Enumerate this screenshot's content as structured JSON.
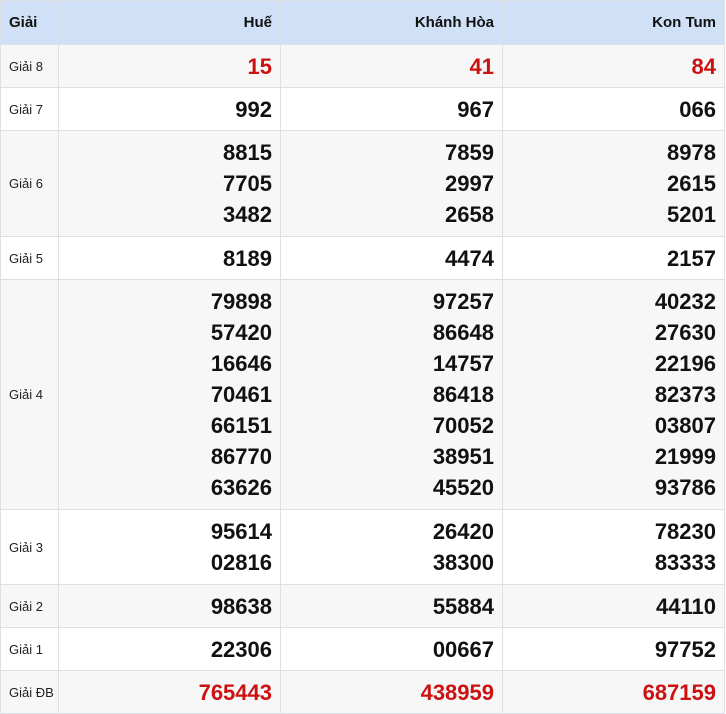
{
  "header": {
    "prize_col": "Giải",
    "provinces": [
      "Huế",
      "Khánh Hòa",
      "Kon Tum"
    ]
  },
  "colors": {
    "accent_header": "#cfe0f7",
    "special_red": "#cc1111"
  },
  "prizes": {
    "g8": {
      "label": "Giải 8",
      "values": [
        [
          "15"
        ],
        [
          "41"
        ],
        [
          "84"
        ]
      ]
    },
    "g7": {
      "label": "Giải 7",
      "values": [
        [
          "992"
        ],
        [
          "967"
        ],
        [
          "066"
        ]
      ]
    },
    "g6": {
      "label": "Giải 6",
      "values": [
        [
          "8815",
          "7705",
          "3482"
        ],
        [
          "7859",
          "2997",
          "2658"
        ],
        [
          "8978",
          "2615",
          "5201"
        ]
      ]
    },
    "g5": {
      "label": "Giải 5",
      "values": [
        [
          "8189"
        ],
        [
          "4474"
        ],
        [
          "2157"
        ]
      ]
    },
    "g4": {
      "label": "Giải 4",
      "values": [
        [
          "79898",
          "57420",
          "16646",
          "70461",
          "66151",
          "86770",
          "63626"
        ],
        [
          "97257",
          "86648",
          "14757",
          "86418",
          "70052",
          "38951",
          "45520"
        ],
        [
          "40232",
          "27630",
          "22196",
          "82373",
          "03807",
          "21999",
          "93786"
        ]
      ]
    },
    "g3": {
      "label": "Giải 3",
      "values": [
        [
          "95614",
          "02816"
        ],
        [
          "26420",
          "38300"
        ],
        [
          "78230",
          "83333"
        ]
      ]
    },
    "g2": {
      "label": "Giải 2",
      "values": [
        [
          "98638"
        ],
        [
          "55884"
        ],
        [
          "44110"
        ]
      ]
    },
    "g1": {
      "label": "Giải 1",
      "values": [
        [
          "22306"
        ],
        [
          "00667"
        ],
        [
          "97752"
        ]
      ]
    },
    "gdb": {
      "label": "Giải ĐB",
      "values": [
        [
          "765443"
        ],
        [
          "438959"
        ],
        [
          "687159"
        ]
      ]
    }
  }
}
